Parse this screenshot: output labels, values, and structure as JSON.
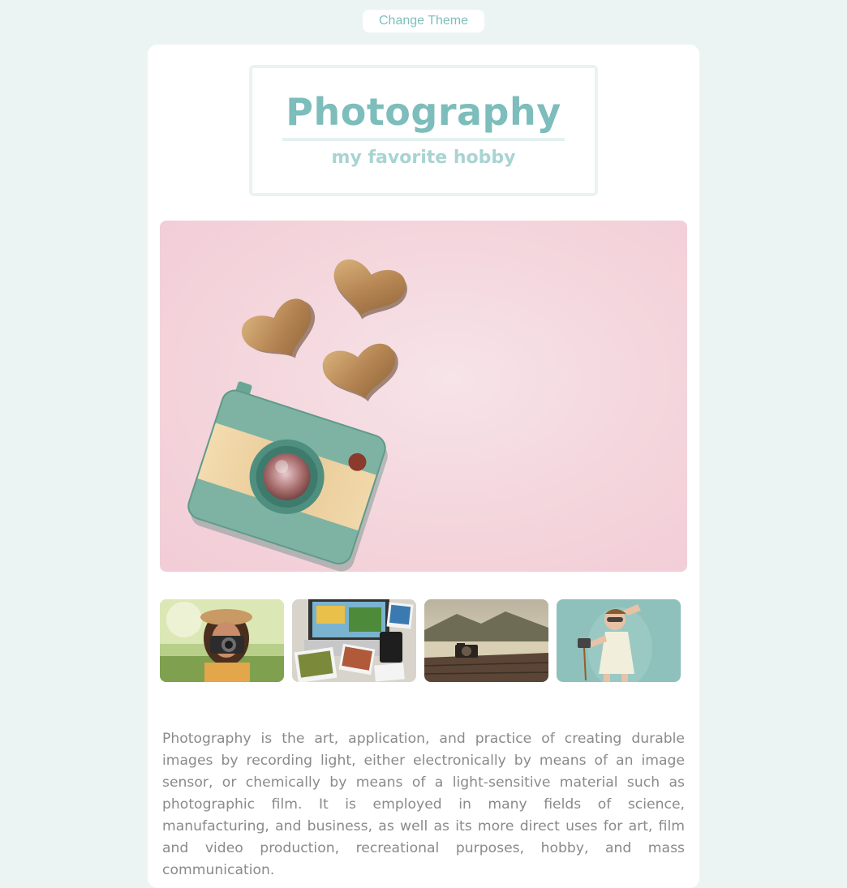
{
  "toolbar": {
    "change_theme_label": "Change Theme"
  },
  "header": {
    "title": "Photography",
    "subtitle": "my favorite hobby"
  },
  "hero": {
    "image_alt": "Toy camera with wooden hearts on pink background"
  },
  "gallery": {
    "items": [
      {
        "alt": "Woman taking photo with camera"
      },
      {
        "alt": "Laptop with scattered photographs"
      },
      {
        "alt": "Camera on wooden dock by lake"
      },
      {
        "alt": "Girl posing with vintage camera"
      }
    ]
  },
  "content": {
    "description": "Photography is the art, application, and practice of creating durable images by recording light, either electronically by means of an image sensor, or chemically by means of a light-sensitive material such as photographic film. It is employed in many fields of science, manufacturing, and business, as well as its more direct uses for art, film and video production, recreational purposes, hobby, and mass communication."
  },
  "colors": {
    "accent": "#7dbdbb",
    "background": "#ecf4f3",
    "hero_background": "#f4d5dc",
    "text": "#8a8a8a"
  }
}
